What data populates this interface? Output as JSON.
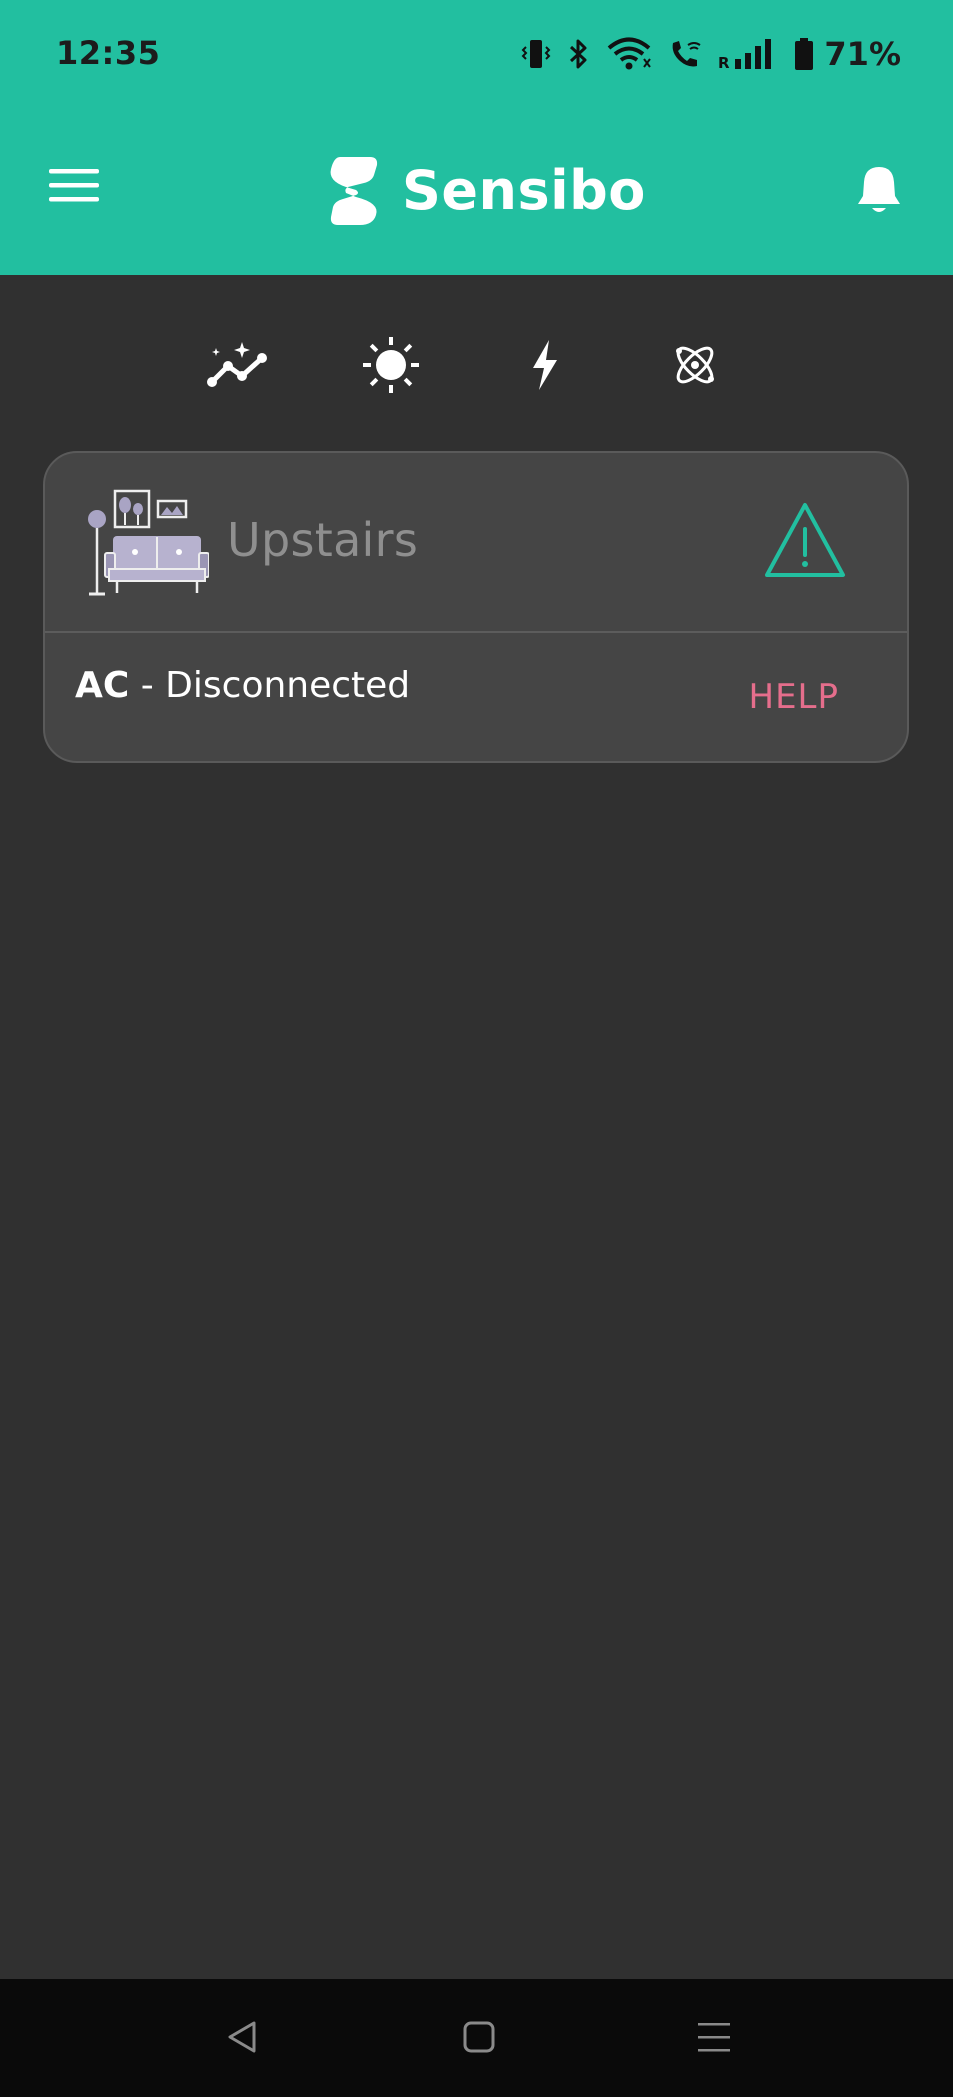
{
  "status_bar": {
    "time": "12:35",
    "battery": "71%",
    "icons": [
      "vibrate-icon",
      "bluetooth-icon",
      "wifi-icon",
      "wifi-calling-icon",
      "signal-icon",
      "battery-icon"
    ]
  },
  "header": {
    "brand": "Sensibo",
    "menu_icon": "hamburger-menu-icon",
    "notification_icon": "bell-icon",
    "background_color": "#22bfa0"
  },
  "mode_icons": [
    "trend-chart-icon",
    "sun-icon",
    "lightning-icon",
    "atom-icon"
  ],
  "rooms": [
    {
      "name": "Upstairs",
      "status_icon": "warning-icon",
      "device": {
        "name": "AC",
        "separator": " - ",
        "status": "Disconnected",
        "action": "HELP"
      }
    }
  ],
  "colors": {
    "accent": "#22bfa0",
    "help": "#e56e8c",
    "background": "#303030",
    "card": "#454545"
  },
  "nav_bar": [
    "back-icon",
    "home-icon",
    "recents-icon"
  ]
}
